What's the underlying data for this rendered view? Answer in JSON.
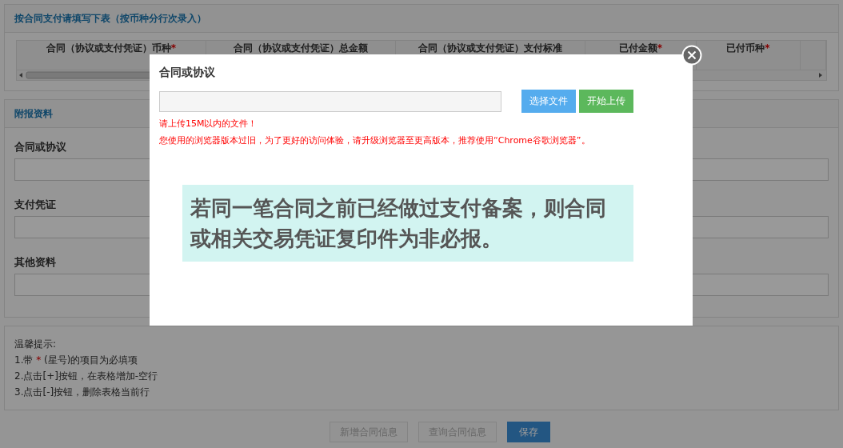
{
  "contract_panel": {
    "title": "按合同支付请填写下表（按币种分行次录入）",
    "table": {
      "columns": [
        {
          "label": "合同（协议或支付凭证）币种",
          "required": true
        },
        {
          "label": "合同（协议或支付凭证）总金额",
          "required": false
        },
        {
          "label": "合同（协议或支付凭证）支付标准",
          "required": false
        },
        {
          "label": "已付金额",
          "required": true
        },
        {
          "label": "已付币种",
          "required": true
        }
      ]
    }
  },
  "attachments_panel": {
    "title": "附报资料",
    "fields": [
      {
        "label": "合同或协议"
      },
      {
        "label": "支付凭证"
      },
      {
        "label": "其他资料"
      }
    ]
  },
  "tips": {
    "title": "温馨提示:",
    "items": [
      {
        "prefix": "1.带",
        "mark": "*",
        "suffix": "(星号)的项目为必填项"
      },
      {
        "prefix": "2.点击[+]按钮，在表格增加-空行"
      },
      {
        "prefix": "3.点击[-]按钮，删除表格当前行"
      }
    ]
  },
  "actions": [
    {
      "label": "新增合同信息",
      "kind": "plain"
    },
    {
      "label": "查询合同信息",
      "kind": "plain"
    },
    {
      "label": "保存",
      "kind": "primary"
    }
  ],
  "dialog": {
    "title": "合同或协议",
    "buttons": [
      {
        "label": "选择文件",
        "kind": "select"
      },
      {
        "label": "开始上传",
        "kind": "upload"
      }
    ],
    "errors": [
      "请上传15M以内的文件！",
      "您使用的浏览器版本过旧，为了更好的访问体验，请升级浏览器至更高版本，推荐使用“Chrome谷歌浏览器”。"
    ],
    "notice": "若同一笔合同之前已经做过支付备案，则合同或相关交易凭证复印件为非必报。"
  }
}
